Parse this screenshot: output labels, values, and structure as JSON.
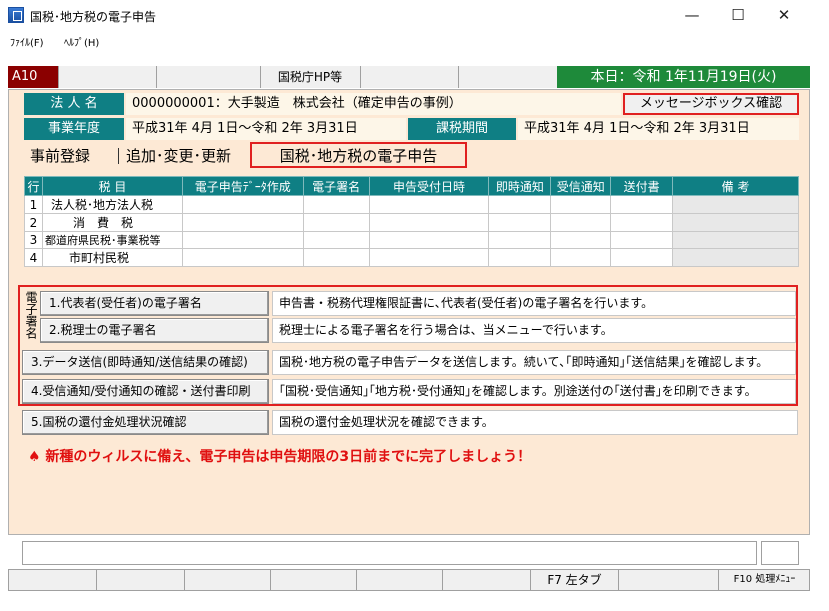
{
  "window": {
    "title": "国税･地方税の電子申告",
    "min": "—",
    "max": "☐",
    "close": "✕"
  },
  "menu": {
    "file": "ﾌｧｲﾙ(F)",
    "help": "ﾍﾙﾌﾟ(H)"
  },
  "toolbar": {
    "code": "A10",
    "hp": "国税庁HP等",
    "today": "本日：令和 1年11月19日(火)"
  },
  "info": {
    "corp_label": "法 人 名",
    "corp_value": "0000000001：大手製造　株式会社（確定申告の事例）",
    "msgbox": "メッセージボックス確認",
    "fy_label": "事業年度",
    "fy_value": "平成31年 4月 1日～令和 2年 3月31日",
    "tax_label": "課税期間",
    "tax_value": "平成31年 4月 1日～令和 2年 3月31日"
  },
  "tabs": [
    "事前登録",
    "追加･変更･更新",
    "国税･地方税の電子申告"
  ],
  "grid": {
    "headers": [
      "行",
      "税 目",
      "電子申告ﾃﾞｰﾀ作成",
      "電子署名",
      "申告受付日時",
      "即時通知",
      "受信通知",
      "送付書",
      "備 考"
    ],
    "rows": [
      {
        "no": "1",
        "name": "法人税･地方法人税"
      },
      {
        "no": "2",
        "name": "消　費　税"
      },
      {
        "no": "3",
        "name": "都道府県民税･事業税等"
      },
      {
        "no": "4",
        "name": "市町村民税"
      }
    ]
  },
  "sig_label": "電子署名",
  "actions": [
    {
      "label": "1.代表者(受任者)の電子署名",
      "desc": "申告書・税務代理権限証書に､代表者(受任者)の電子署名を行います。"
    },
    {
      "label": "2.税理士の電子署名",
      "desc": "税理士による電子署名を行う場合は、当メニューで行います。"
    },
    {
      "label": "3.データ送信(即時通知/送信結果の確認)",
      "desc": "国税･地方税の電子申告データを送信します。続いて､｢即時通知｣｢送信結果｣を確認します。"
    },
    {
      "label": "4.受信通知/受付通知の確認・送付書印刷",
      "desc": "｢国税･受信通知｣｢地方税･受付通知｣を確認します。別途送付の｢送付書｣を印刷できます。"
    },
    {
      "label": "5.国税の還付金処理状況確認",
      "desc": "国税の還付金処理状況を確認できます。"
    }
  ],
  "warning": "♠ 新種のウィルスに備え、電子申告は申告期限の3日前までに完了しましょう！",
  "fkeys": {
    "f7": "F7 左タブ",
    "f10": "F10 処理ﾒﾆｭｰ"
  },
  "colors": {
    "teal": "#0f7f84",
    "peach": "#fde9d5",
    "red": "#e02020",
    "green": "#1e8a3a",
    "code_bg": "#8b0000"
  }
}
